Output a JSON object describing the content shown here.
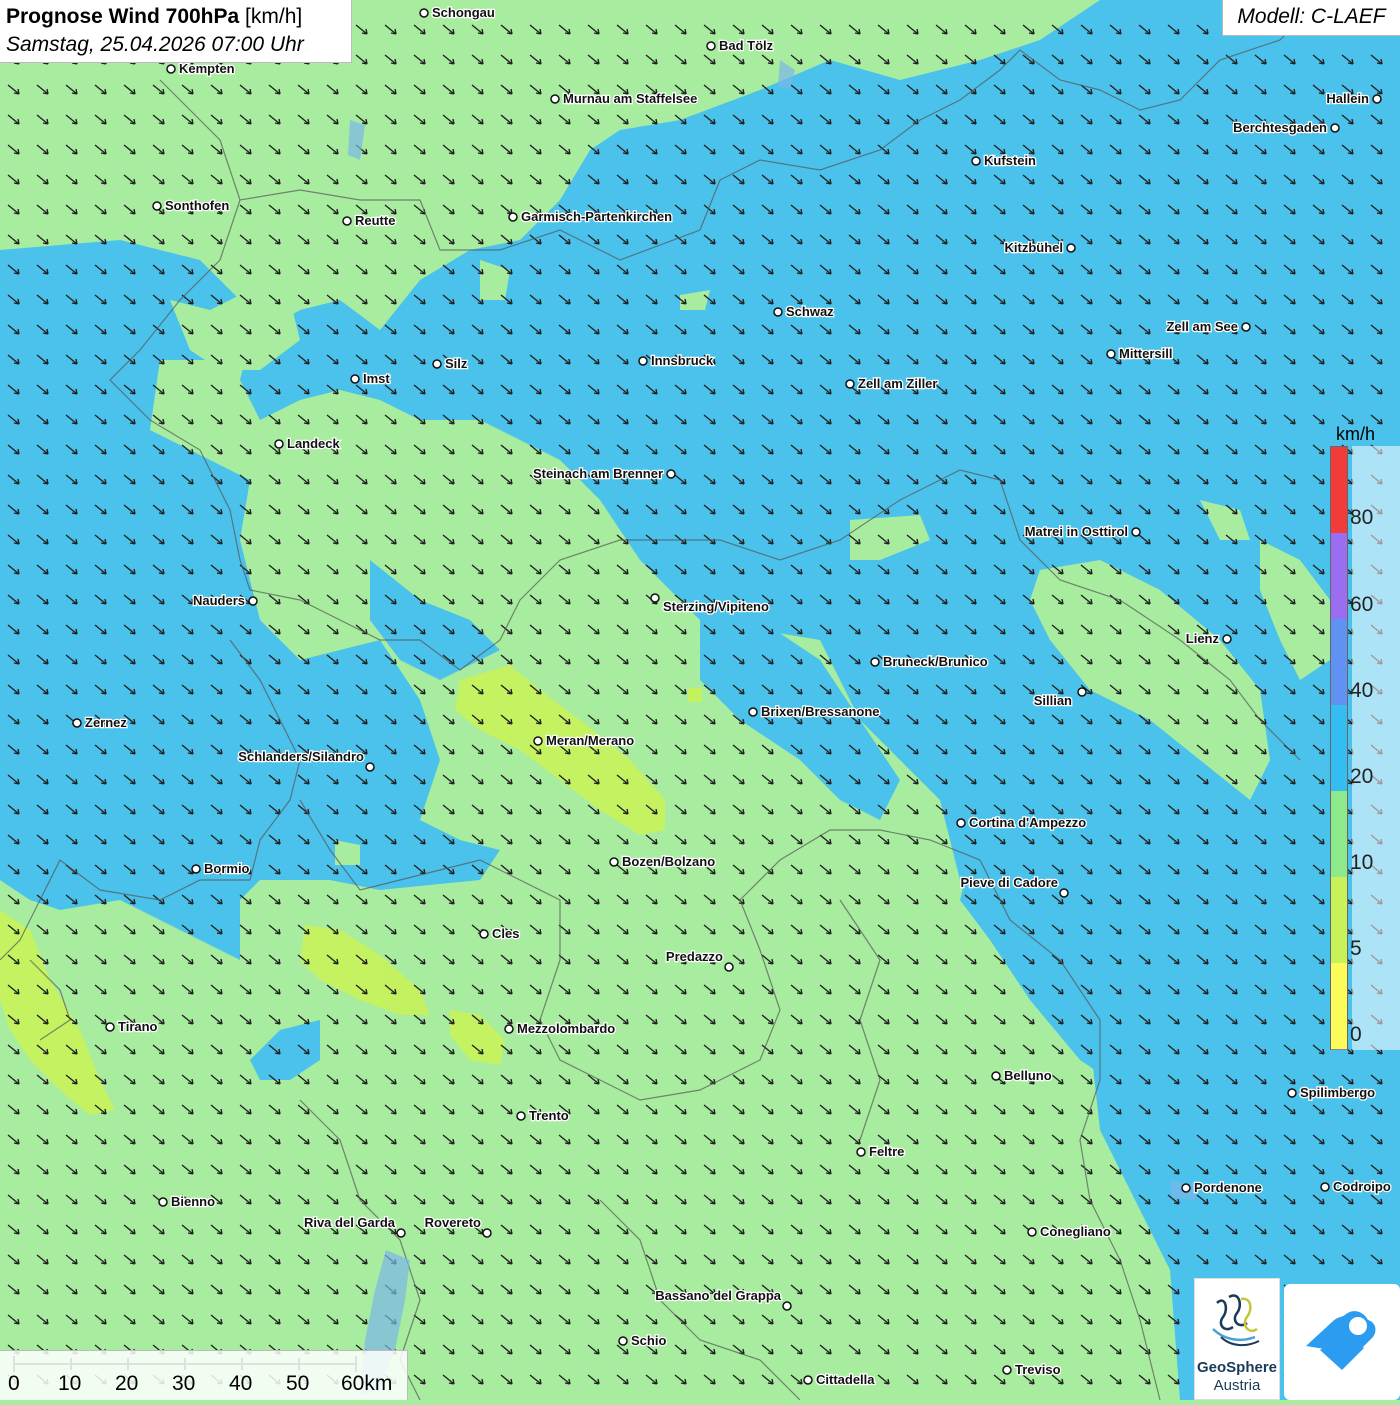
{
  "title": {
    "main": "Prognose Wind 700hPa",
    "unit": "[km/h]",
    "datetime": "Samstag, 25.04.2026 07:00 Uhr"
  },
  "model": "Modell: C-LAEF",
  "legend": {
    "unit": "km/h",
    "labels": [
      "80",
      "60",
      "40",
      "20",
      "10",
      "5",
      "0"
    ],
    "colors": [
      "#f23b3b",
      "#9b6df0",
      "#5f92f2",
      "#33bdf0",
      "#8cea8a",
      "#c8f25a",
      "#fbfb5a"
    ]
  },
  "scale": {
    "labels": [
      "0",
      "10",
      "20",
      "30",
      "40",
      "50",
      "60km"
    ]
  },
  "logo": {
    "name_line1": "GeoSphere",
    "name_line2": "Austria"
  },
  "colors": {
    "wind_low": "#fbfb5a",
    "wind_5": "#c8f25a",
    "wind_10": "#a8ed9f",
    "wind_20": "#45c0f0",
    "app_logo": "#2b9cf0"
  },
  "cities": [
    {
      "name": "Schongau"
    },
    {
      "name": "Bad Tölz"
    },
    {
      "name": "Kempten"
    },
    {
      "name": "Murnau am Staffelsee"
    },
    {
      "name": "Hallein"
    },
    {
      "name": "Berchtesgaden"
    },
    {
      "name": "Kufstein"
    },
    {
      "name": "Sonthofen"
    },
    {
      "name": "Reutte"
    },
    {
      "name": "Garmisch-Partenkirchen"
    },
    {
      "name": "Kitzbühel"
    },
    {
      "name": "Schwaz"
    },
    {
      "name": "Zell am See"
    },
    {
      "name": "Mittersill"
    },
    {
      "name": "Innsbruck"
    },
    {
      "name": "Silz"
    },
    {
      "name": "Imst"
    },
    {
      "name": "Zell am Ziller"
    },
    {
      "name": "Landeck"
    },
    {
      "name": "Steinach am Brenner"
    },
    {
      "name": "Matrei in Osttirol"
    },
    {
      "name": "Nauders"
    },
    {
      "name": "Sterzing/Vipiteno"
    },
    {
      "name": "Lienz"
    },
    {
      "name": "Bruneck/Brunico"
    },
    {
      "name": "Sillian"
    },
    {
      "name": "Brixen/Bressanone"
    },
    {
      "name": "Zernez"
    },
    {
      "name": "Meran/Merano"
    },
    {
      "name": "Schlanders/Silandro"
    },
    {
      "name": "Cortina d'Ampezzo"
    },
    {
      "name": "Bozen/Bolzano"
    },
    {
      "name": "Bormio"
    },
    {
      "name": "Pieve di Cadore"
    },
    {
      "name": "Cles"
    },
    {
      "name": "Predazzo"
    },
    {
      "name": "Tirano"
    },
    {
      "name": "Mezzolombardo"
    },
    {
      "name": "Belluno"
    },
    {
      "name": "Spilimbergo"
    },
    {
      "name": "Trento"
    },
    {
      "name": "Feltre"
    },
    {
      "name": "Pordenone"
    },
    {
      "name": "Codroipo"
    },
    {
      "name": "Bienno"
    },
    {
      "name": "Riva del Garda"
    },
    {
      "name": "Rovereto"
    },
    {
      "name": "Conegliano"
    },
    {
      "name": "Bassano del Grappa"
    },
    {
      "name": "Schio"
    },
    {
      "name": "Treviso"
    },
    {
      "name": "Cittadella"
    }
  ]
}
